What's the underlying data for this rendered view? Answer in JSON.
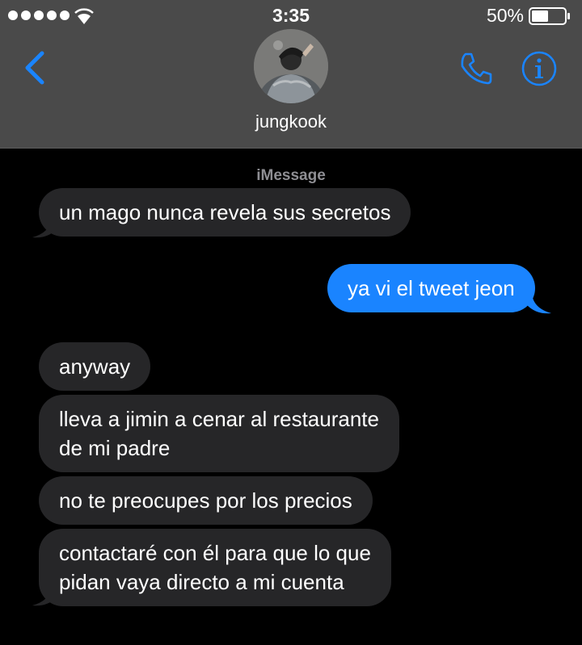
{
  "status_bar": {
    "time": "3:35",
    "battery": "50%"
  },
  "header": {
    "contact_name": "jungkook",
    "accent_color": "#1a84ff",
    "back_icon": "chevron-left-icon",
    "call_icon": "phone-icon",
    "info_icon": "info-icon"
  },
  "conversation": {
    "service_label": "iMessage",
    "messages": [
      {
        "direction": "received",
        "lines": [
          "un mago nunca revela sus secretos"
        ]
      },
      {
        "direction": "sent",
        "lines": [
          "ya vi el tweet jeon"
        ]
      },
      {
        "direction": "received",
        "lines": [
          "anyway"
        ]
      },
      {
        "direction": "received",
        "lines": [
          "lleva a jimin a cenar al restaurante",
          "de mi padre"
        ]
      },
      {
        "direction": "received",
        "lines": [
          "no te preocupes por los precios"
        ]
      },
      {
        "direction": "received",
        "lines": [
          "contactaré con él para que lo que",
          "pidan vaya directo a mi cuenta"
        ]
      }
    ]
  }
}
